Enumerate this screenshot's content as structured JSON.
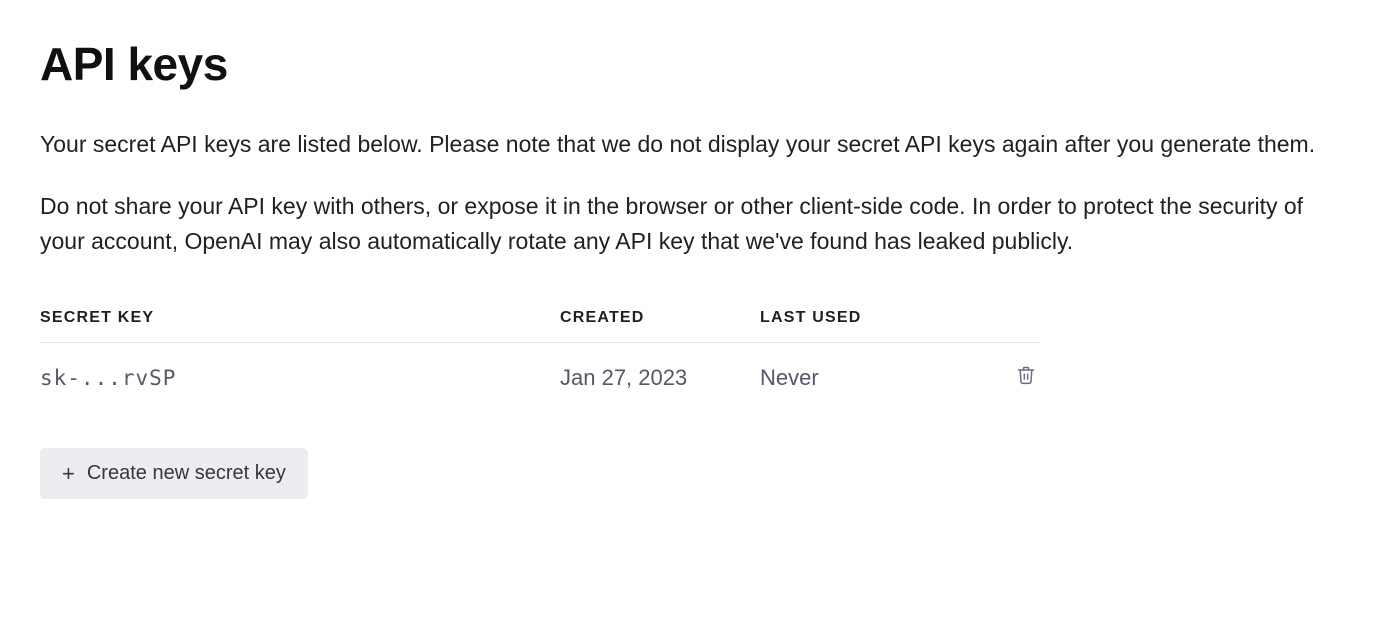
{
  "page": {
    "title": "API keys",
    "description1": "Your secret API keys are listed below. Please note that we do not display your secret API keys again after you generate them.",
    "description2": "Do not share your API key with others, or expose it in the browser or other client-side code. In order to protect the security of your account, OpenAI may also automatically rotate any API key that we've found has leaked publicly."
  },
  "table": {
    "headers": {
      "secret_key": "SECRET KEY",
      "created": "CREATED",
      "last_used": "LAST USED"
    },
    "rows": [
      {
        "key": "sk-...rvSP",
        "created": "Jan 27, 2023",
        "last_used": "Never"
      }
    ]
  },
  "actions": {
    "create_label": "Create new secret key"
  }
}
